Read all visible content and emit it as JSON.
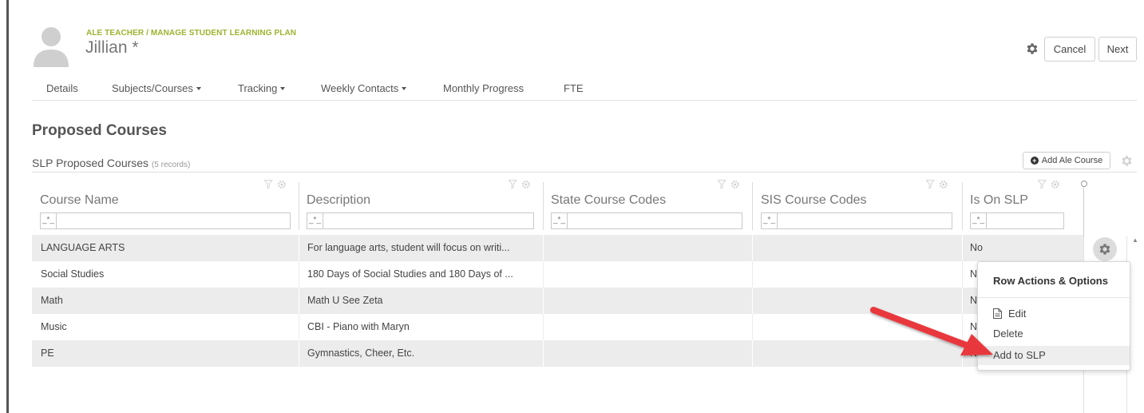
{
  "header": {
    "breadcrumb": "ALE TEACHER / MANAGE STUDENT LEARNING PLAN",
    "student_name": "Jillian *",
    "cancel_label": "Cancel",
    "next_label": "Next"
  },
  "nav": {
    "items": [
      {
        "label": "Details",
        "dropdown": false
      },
      {
        "label": "Subjects/Courses",
        "dropdown": true
      },
      {
        "label": "Tracking",
        "dropdown": true
      },
      {
        "label": "Weekly Contacts",
        "dropdown": true
      },
      {
        "label": "Monthly Progress",
        "dropdown": false
      },
      {
        "label": "FTE",
        "dropdown": false
      }
    ]
  },
  "section": {
    "title": "Proposed Courses"
  },
  "grid": {
    "title": "SLP Proposed Courses",
    "record_count": "(5 records)",
    "add_button_label": "Add Ale Course",
    "filter_operator": "_*_",
    "columns": [
      {
        "label": "Course Name"
      },
      {
        "label": "Description"
      },
      {
        "label": "State Course Codes"
      },
      {
        "label": "SIS Course Codes"
      },
      {
        "label": "Is On SLP"
      }
    ],
    "rows": [
      {
        "course_name": "LANGUAGE ARTS",
        "description": "For language arts, student will focus on writi...",
        "state_codes": "",
        "sis_codes": "",
        "is_on_slp": "No"
      },
      {
        "course_name": "Social Studies",
        "description": "180 Days of Social Studies and 180 Days of ...",
        "state_codes": "",
        "sis_codes": "",
        "is_on_slp": "N"
      },
      {
        "course_name": "Math",
        "description": "Math U See Zeta",
        "state_codes": "",
        "sis_codes": "",
        "is_on_slp": "N"
      },
      {
        "course_name": "Music",
        "description": "CBI - Piano with Maryn",
        "state_codes": "",
        "sis_codes": "",
        "is_on_slp": "N"
      },
      {
        "course_name": "PE",
        "description": "Gymnastics, Cheer, Etc.",
        "state_codes": "",
        "sis_codes": "",
        "is_on_slp": "N"
      }
    ]
  },
  "row_menu": {
    "title": "Row Actions & Options",
    "items": [
      {
        "label": "Edit",
        "icon": "document-edit-icon"
      },
      {
        "label": "Delete"
      },
      {
        "label": "Add to SLP"
      }
    ]
  },
  "colors": {
    "breadcrumb": "#9db330",
    "annotation_arrow": "#e8393e",
    "row_shade": "#ececec"
  }
}
